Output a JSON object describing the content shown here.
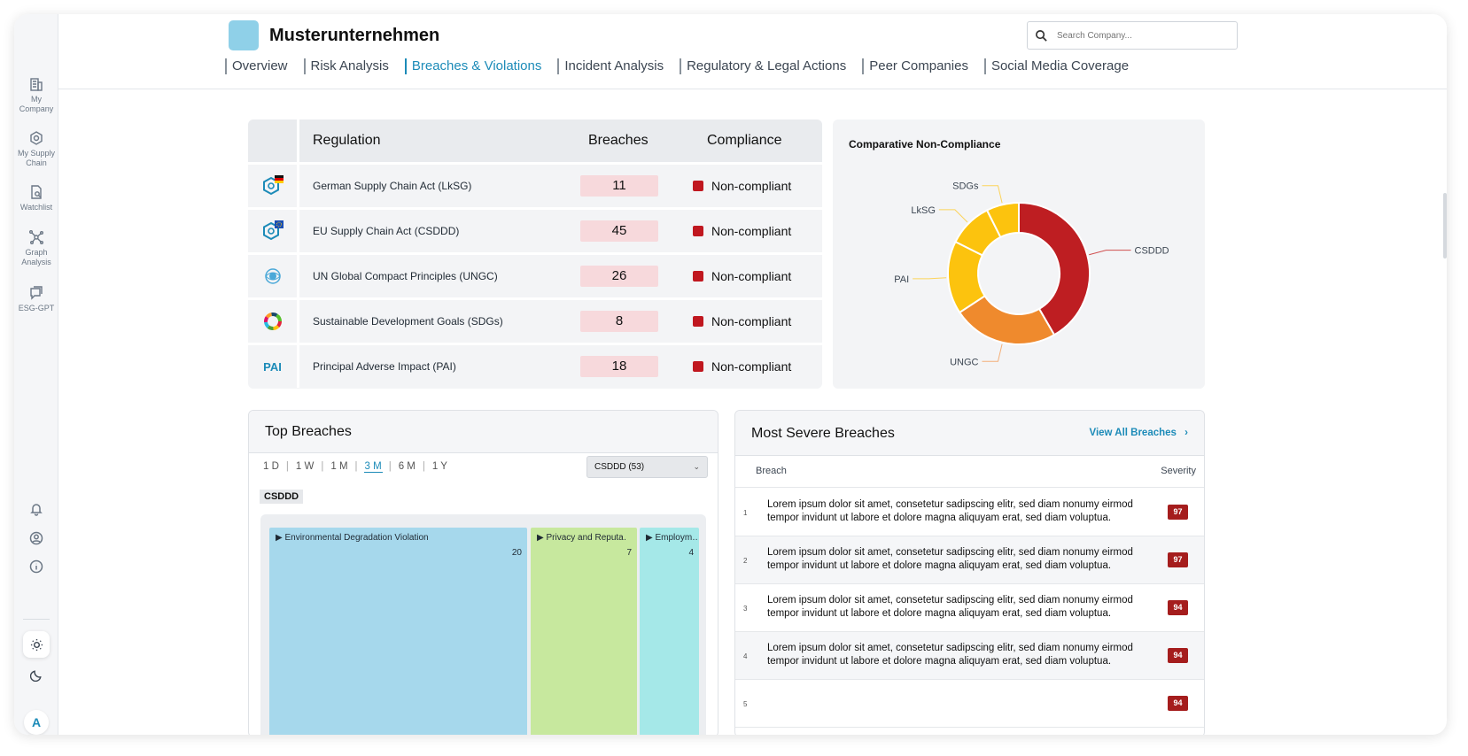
{
  "sidebar": {
    "items": [
      {
        "label": "My Company",
        "icon": "building-icon"
      },
      {
        "label": "My Supply Chain",
        "icon": "hexagon-network-icon"
      },
      {
        "label": "Watchlist",
        "icon": "document-search-icon"
      },
      {
        "label": "Graph Analysis",
        "icon": "graph-nodes-icon"
      },
      {
        "label": "ESG-GPT",
        "icon": "chat-icon"
      }
    ],
    "avatar_initial": "A"
  },
  "header": {
    "company_name": "Musterunternehmen",
    "search_placeholder": "Search Company...",
    "tabs": [
      {
        "label": "Overview",
        "active": false
      },
      {
        "label": "Risk Analysis",
        "active": false
      },
      {
        "label": "Breaches & Violations",
        "active": true
      },
      {
        "label": "Incident Analysis",
        "active": false
      },
      {
        "label": "Regulatory & Legal Actions",
        "active": false
      },
      {
        "label": "Peer Companies",
        "active": false
      },
      {
        "label": "Social Media Coverage",
        "active": false
      }
    ]
  },
  "regulations": {
    "headers": {
      "regulation": "Regulation",
      "breaches": "Breaches",
      "compliance": "Compliance"
    },
    "rows": [
      {
        "name": "German Supply Chain Act (LkSG)",
        "breaches": "11",
        "status": "Non-compliant"
      },
      {
        "name": "EU Supply Chain Act (CSDDD)",
        "breaches": "45",
        "status": "Non-compliant"
      },
      {
        "name": "UN Global Compact Principles (UNGC)",
        "breaches": "26",
        "status": "Non-compliant"
      },
      {
        "name": "Sustainable Development Goals (SDGs)",
        "breaches": "8",
        "status": "Non-compliant"
      },
      {
        "name": "Principal Adverse Impact (PAI)",
        "breaches": "18",
        "status": "Non-compliant",
        "logo_text": "PAI"
      }
    ]
  },
  "comparative": {
    "title": "Comparative Non-Compliance"
  },
  "chart_data": {
    "type": "pie",
    "title": "Comparative Non-Compliance",
    "categories": [
      "CSDDD",
      "UNGC",
      "PAI",
      "LkSG",
      "SDGs"
    ],
    "values": [
      45,
      26,
      18,
      11,
      8
    ],
    "colors": [
      "#be1e22",
      "#ef8a2d",
      "#fcc30e",
      "#fcc30e",
      "#fcc30e"
    ]
  },
  "top_breaches": {
    "title": "Top Breaches",
    "ranges": [
      "1 D",
      "1 W",
      "1 M",
      "3 M",
      "6 M",
      "1 Y"
    ],
    "active_range": "3 M",
    "selected": "CSDDD (53)",
    "tag": "CSDDD",
    "tiles": [
      {
        "label": "▶ Environmental Degradation Violation",
        "value": "20",
        "color": "#a6d8ec"
      },
      {
        "label": "▶ Privacy and Reputa…",
        "value": "7",
        "color": "#c7e89e"
      },
      {
        "label": "▶ Employm…",
        "value": "4",
        "color": "#a5e8e8"
      }
    ]
  },
  "most_severe": {
    "title": "Most Severe Breaches",
    "view_all": "View All Breaches",
    "col_breach": "Breach",
    "col_severity": "Severity",
    "rows": [
      {
        "num": "1",
        "text": "Lorem ipsum dolor sit amet, consetetur sadipscing elitr, sed diam nonumy eirmod tempor invidunt ut labore et dolore magna aliquyam erat, sed diam voluptua.",
        "severity": "97"
      },
      {
        "num": "2",
        "text": "Lorem ipsum dolor sit amet, consetetur sadipscing elitr, sed diam nonumy eirmod tempor invidunt ut labore et dolore magna aliquyam erat, sed diam voluptua.",
        "severity": "97"
      },
      {
        "num": "3",
        "text": "Lorem ipsum dolor sit amet, consetetur sadipscing elitr, sed diam nonumy eirmod tempor invidunt ut labore et dolore magna aliquyam erat, sed diam voluptua.",
        "severity": "94"
      },
      {
        "num": "4",
        "text": "Lorem ipsum dolor sit amet, consetetur sadipscing elitr, sed diam nonumy eirmod tempor invidunt ut labore et dolore magna aliquyam erat, sed diam voluptua.",
        "severity": "94"
      },
      {
        "num": "5",
        "text": "",
        "severity": "94"
      }
    ]
  }
}
